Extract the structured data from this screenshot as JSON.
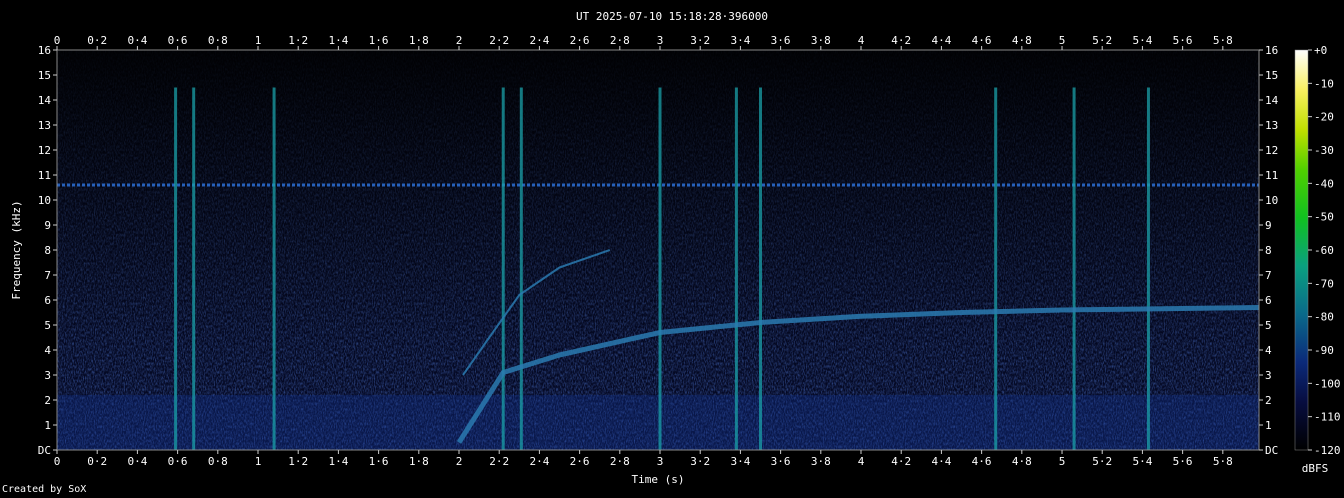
{
  "chart_data": {
    "type": "heatmap",
    "title": "UT 2025-07-10 15:18:28·396000",
    "xlabel": "Time (s)",
    "ylabel": "Frequency (kHz)",
    "xlim": [
      0,
      5.98
    ],
    "ylim": [
      0,
      16
    ],
    "x_ticks": [
      "0",
      "0·2",
      "0·4",
      "0·6",
      "0·8",
      "1",
      "1·2",
      "1·4",
      "1·6",
      "1·8",
      "2",
      "2·2",
      "2·4",
      "2·6",
      "2·8",
      "3",
      "3·2",
      "3·4",
      "3·6",
      "3·8",
      "4",
      "4·2",
      "4·4",
      "4·6",
      "4·8",
      "5",
      "5·2",
      "5·4",
      "5·6",
      "5·8"
    ],
    "y_ticks": [
      "DC",
      "1",
      "2",
      "3",
      "4",
      "5",
      "6",
      "7",
      "8",
      "9",
      "10",
      "11",
      "12",
      "13",
      "14",
      "15",
      "16"
    ],
    "colorbar": {
      "label": "dBFS",
      "ticks": [
        "+0",
        "-10",
        "-20",
        "-30",
        "-40",
        "-50",
        "-60",
        "-70",
        "-80",
        "-90",
        "-100",
        "-110",
        "-120"
      ],
      "range": [
        -120,
        0
      ]
    },
    "features": {
      "horizontal_tone_khz": 10.6,
      "impulses_s": [
        0.59,
        0.68,
        1.08,
        2.22,
        2.31,
        3.0,
        3.38,
        3.5,
        4.67,
        5.06,
        5.43
      ],
      "sweep_upper": {
        "t": [
          2.02,
          2.15,
          2.3,
          2.5,
          2.75
        ],
        "f_khz": [
          3.0,
          4.5,
          6.2,
          7.3,
          8.0
        ]
      },
      "sweep_lower": {
        "t": [
          2.0,
          2.22,
          2.5,
          3.0,
          3.5,
          4.0,
          4.5,
          5.0,
          5.5,
          5.98
        ],
        "f_khz": [
          0.3,
          3.1,
          3.8,
          4.7,
          5.1,
          5.35,
          5.5,
          5.6,
          5.65,
          5.7
        ]
      }
    },
    "grid": false,
    "legend": "colorbar-right"
  },
  "colors": {
    "background": "#000000",
    "plot_noise": "#0a1a55",
    "tone": "#2a6acc",
    "impulse": "#1aa0a8"
  },
  "credit": "Created by SoX"
}
